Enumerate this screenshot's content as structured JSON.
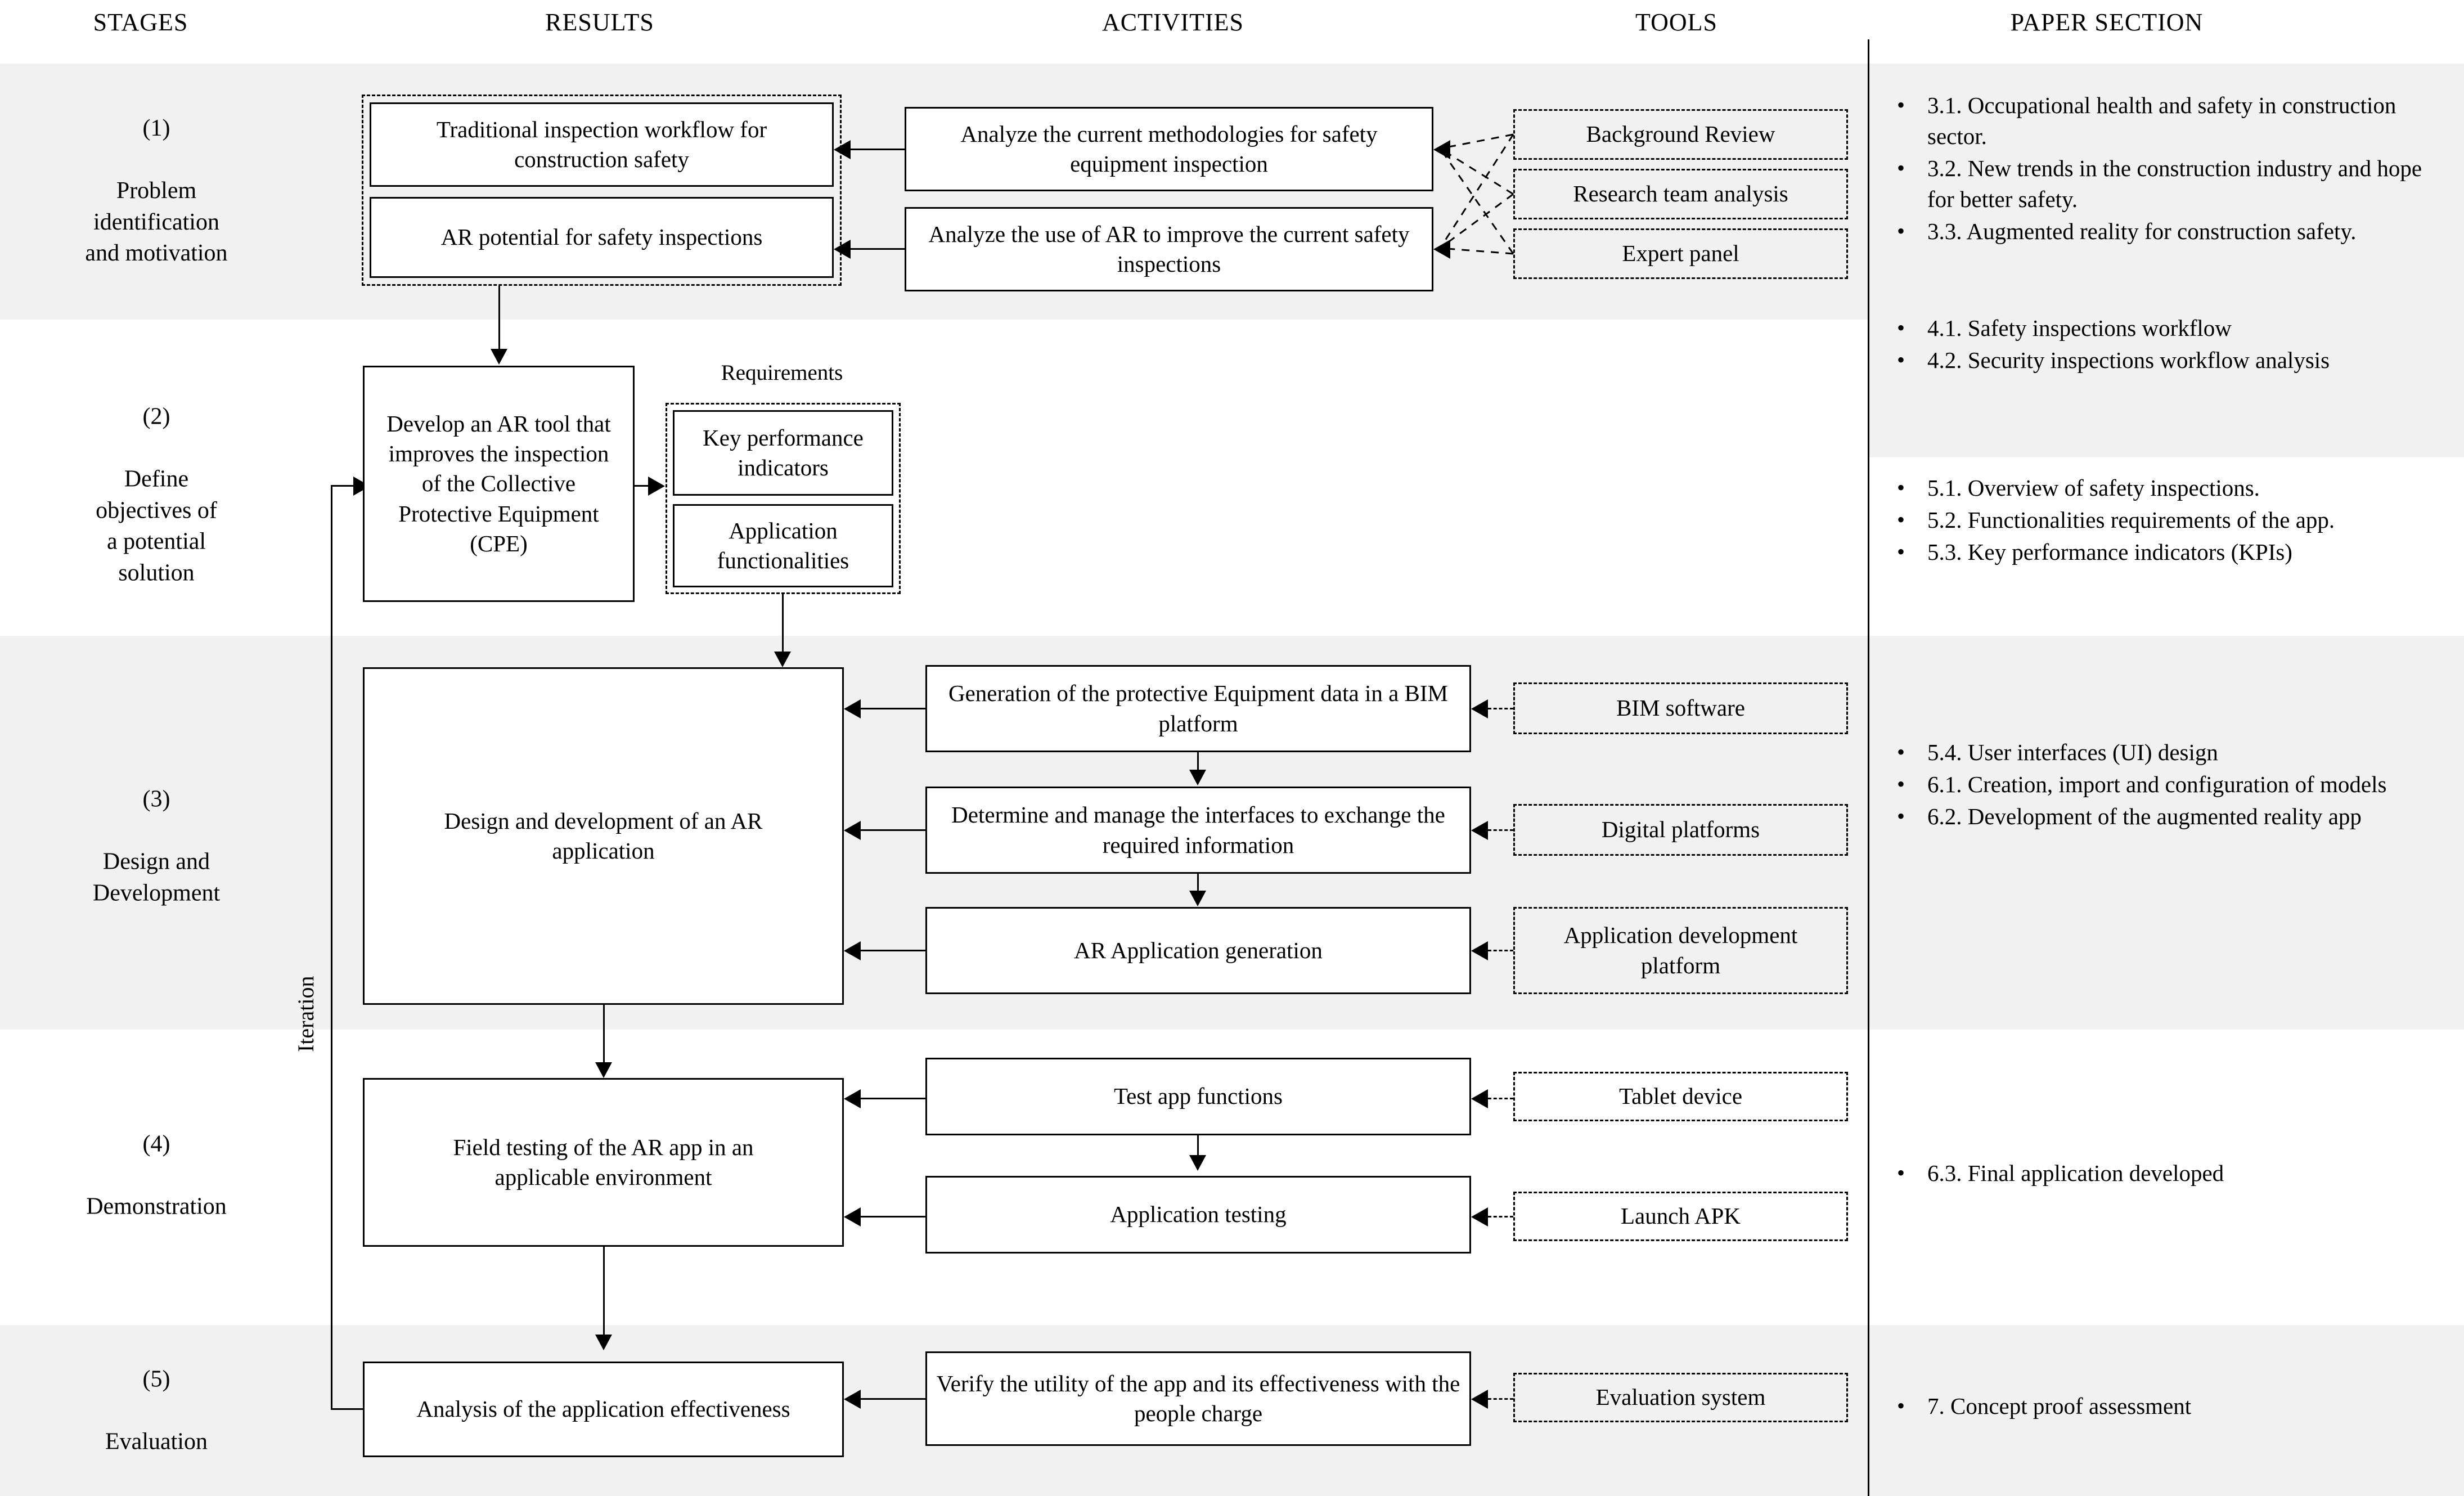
{
  "headers": {
    "stages": "STAGES",
    "results": "RESULTS",
    "activities": "ACTIVITIES",
    "tools": "TOOLS",
    "paper_section": "PAPER SECTION"
  },
  "colors": {
    "band": "#f1f1f1",
    "line": "#000000",
    "background": "#ffffff"
  },
  "iteration_label": "Iteration",
  "requirements_caption": "Requirements",
  "stages": [
    {
      "number": "(1)",
      "name": "Problem\nidentification\nand motivation"
    },
    {
      "number": "(2)",
      "name": "Define\nobjectives of\na potential\nsolution"
    },
    {
      "number": "(3)",
      "name": "Design and\nDevelopment"
    },
    {
      "number": "(4)",
      "name": "Demonstration"
    },
    {
      "number": "(5)",
      "name": "Evaluation"
    }
  ],
  "results": {
    "r1a": "Traditional inspection workflow for construction safety",
    "r1b": "AR potential for safety inspections",
    "r2": "Develop an AR tool that improves the inspection of the Collective Protective Equipment (CPE)",
    "r2_req_a": "Key performance indicators",
    "r2_req_b": "Application functionalities",
    "r3": "Design and development of an AR application",
    "r4": "Field testing of the AR app in an applicable environment",
    "r5": "Analysis of the application effectiveness"
  },
  "activities": {
    "a1a": "Analyze the current methodologies for safety equipment inspection",
    "a1b": "Analyze the use of AR to improve the current safety inspections",
    "a3a": "Generation of the protective Equipment data in a BIM platform",
    "a3b": "Determine and manage the interfaces to exchange the required information",
    "a3c": "AR Application generation",
    "a4a": "Test app functions",
    "a4b": "Application testing",
    "a5": "Verify the utility of the app and its effectiveness with the people charge"
  },
  "tools": {
    "t1a": "Background Review",
    "t1b": "Research team analysis",
    "t1c": "Expert panel",
    "t3a": "BIM software",
    "t3b": "Digital platforms",
    "t3c": "Application development platform",
    "t4a": "Tablet device",
    "t4b": "Launch APK",
    "t5": "Evaluation system"
  },
  "paper_section": {
    "group1": [
      "3.1. Occupational health and safety in construction sector.",
      "3.2. New trends in the construction industry and hope for better safety.",
      "3.3. Augmented reality for construction safety."
    ],
    "group2": [
      "4.1. Safety inspections workflow",
      "4.2. Security inspections workflow analysis"
    ],
    "group3": [
      "5.1. Overview of safety inspections.",
      "5.2. Functionalities requirements of the app.",
      "5.3. Key performance indicators (KPIs)"
    ],
    "group4": [
      "5.4. User interfaces (UI) design",
      "6.1. Creation, import and configuration of models",
      "6.2. Development of the augmented reality app"
    ],
    "group5": [
      "6.3. Final application developed"
    ],
    "group6": [
      "7. Concept proof assessment"
    ],
    "bullet_glyph": "•"
  }
}
